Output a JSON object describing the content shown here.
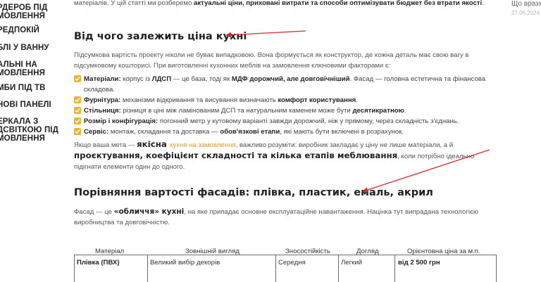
{
  "sidebar": {
    "items": [
      {
        "label": "РДЕРОБ ПІД\nМОВЛЕННЯ"
      },
      {
        "label": "РЕДПОКІЙ"
      },
      {
        "label": "БЛІ У ВАННУ"
      },
      {
        "label": "АЛЬНІ НА\nМОВЛЕННЯ"
      },
      {
        "label": "МБИ ПІД ТВ"
      },
      {
        "label": "НОВІ ПАНЕЛІ"
      },
      {
        "label": "ЕРКАЛА З\nДСВІТКОЮ ПІД\nМОВЛЕННЯ"
      }
    ]
  },
  "right_column": {
    "title": "Що вразх",
    "date": "27.05.2024"
  },
  "intro": {
    "text_before": "матеріалів. У цій статті ми розберемо ",
    "bold": "актуальні ціни, приховані витрати та способи оптимізувати бюджет без втрати якості",
    "text_after": "."
  },
  "section1": {
    "heading": "Від чого залежить ціна кухні",
    "paragraph": "Підсумкова вартість проекту ніколи не буває випадковою. Вона формується як конструктор, де кожна деталь має свою вагу в підсумковому кошториcі. При виготовленні кухонних меблів на замовлення ключовими факторами є:"
  },
  "factors": [
    {
      "label": "Матеріали:",
      "text": " корпус із ",
      "b1": "ЛДСП",
      "t2": " — це база, тоді як ",
      "b2": "МДФ дорожчий, але довговічніший",
      "t3": ". Фасад — головна естетична та фінансова складова."
    },
    {
      "label": "Фурнітура:",
      "text": " механізми відкривання та висування визначають ",
      "b1": "комфорт користування",
      "t2": ".",
      "b2": "",
      "t3": ""
    },
    {
      "label": "Стільниця:",
      "text": " різниця в ціні між ламінованим ДСП та натуральним каменем може бути ",
      "b1": "десятикратною",
      "t2": ".",
      "b2": "",
      "t3": ""
    },
    {
      "label": "Розмір і конфігурація:",
      "text": " погонний метр у кутовому варіанті завжди дорожчий, ніж у прямому, через складність з'єднань.",
      "b1": "",
      "t2": "",
      "b2": "",
      "t3": ""
    },
    {
      "label": "Сервіс:",
      "text": " монтаж, складання та доставка — ",
      "b1": "обов'язкові етапи",
      "t2": ", які мають бути включені в розрахунок.",
      "b2": "",
      "t3": ""
    }
  ],
  "summary": {
    "t1": "Якщо ваша мета — ",
    "b1": "якісна ",
    "link": "кухня на замовлення",
    "t2": ", важливо розуміти: виробник закладає у ціну не лише матеріали, а й ",
    "b2": "проєктування, коефіцієнт складності та кілька етапів меблювання",
    "t3": ", коли потрібно ідеально підігнати елементи один до одного."
  },
  "section2": {
    "heading": "Порівняння вартості фасадів: плівка, пластик, емаль, акрил",
    "t1": "Фасад — це ",
    "b1": "«обличчя» кухні",
    "t2": ", на яке припадає основне експлуатаційне навантаження. Націнка тут випрадана технологією виробництва та довговічністю."
  },
  "table": {
    "headers": [
      "Матеріал",
      "Зовнішній вигляд",
      "Зносостійкість",
      "Догляд",
      "Орієнтовна ціна за м.п."
    ],
    "rows": [
      [
        "Плівка (ПВХ)",
        "Великий вибір декорів",
        "Середня",
        "Легкий",
        "від 2 500 грн"
      ]
    ]
  },
  "colors": {
    "accent": "#f0b429",
    "link": "#e39a2d",
    "annotation_arrow": "#d42a2a"
  }
}
